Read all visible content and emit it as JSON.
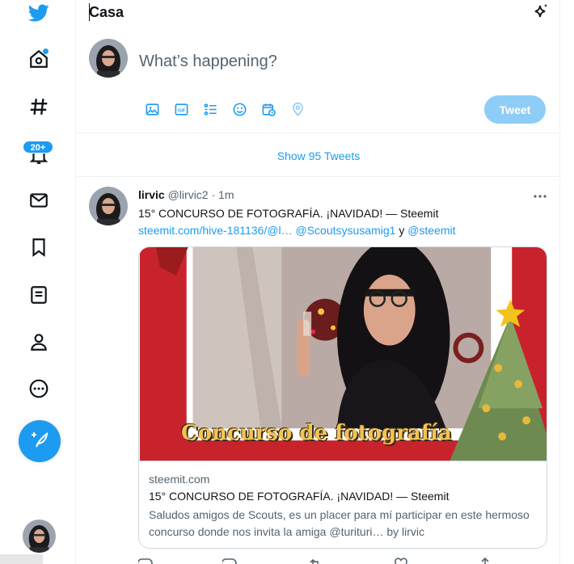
{
  "nav": {
    "logo_icon": "twitter-bird-icon",
    "items": [
      {
        "icon": "home-icon",
        "unread_dot": true
      },
      {
        "icon": "hashtag-icon"
      },
      {
        "icon": "bell-icon",
        "badge": "20+"
      },
      {
        "icon": "envelope-icon"
      },
      {
        "icon": "bookmark-icon"
      },
      {
        "icon": "list-icon"
      },
      {
        "icon": "person-icon"
      },
      {
        "icon": "more-circle-icon"
      }
    ],
    "compose_icon": "feather-plus-icon"
  },
  "header": {
    "title": "Casa",
    "icon": "sparkle-icon"
  },
  "composer": {
    "placeholder": "What’s happening?",
    "tools": [
      "image-icon",
      "gif-icon",
      "poll-icon",
      "emoji-icon",
      "schedule-icon",
      "location-icon"
    ],
    "tweet_label": "Tweet"
  },
  "show_tweets": "Show 95 Tweets",
  "tweet": {
    "name": "lirvic",
    "handle": "@lirvic2",
    "separator": "·",
    "time": "1m",
    "line1": "15° CONCURSO DE FOTOGRAFÍA. ¡NAVIDAD! — Steemit",
    "link_url": "steemit.com/hive-181136/@l…",
    "mention1": "@Scoutsysusamig1",
    "conjunction": "y",
    "mention2": "@steemit",
    "card": {
      "image_caption": "Concurso de fotografía",
      "domain": "steemit.com",
      "title": "15° CONCURSO DE FOTOGRAFÍA. ¡NAVIDAD! — Steemit",
      "description": "Saludos amigos de Scouts, es un placer para mí participar en este hermoso concurso donde nos invita la amiga @turituri… by lirvic"
    }
  },
  "colors": {
    "accent": "#1d9bf0",
    "tweet_button_disabled": "#8ecdf8",
    "text_primary": "#0f1419",
    "text_secondary": "#536471"
  }
}
